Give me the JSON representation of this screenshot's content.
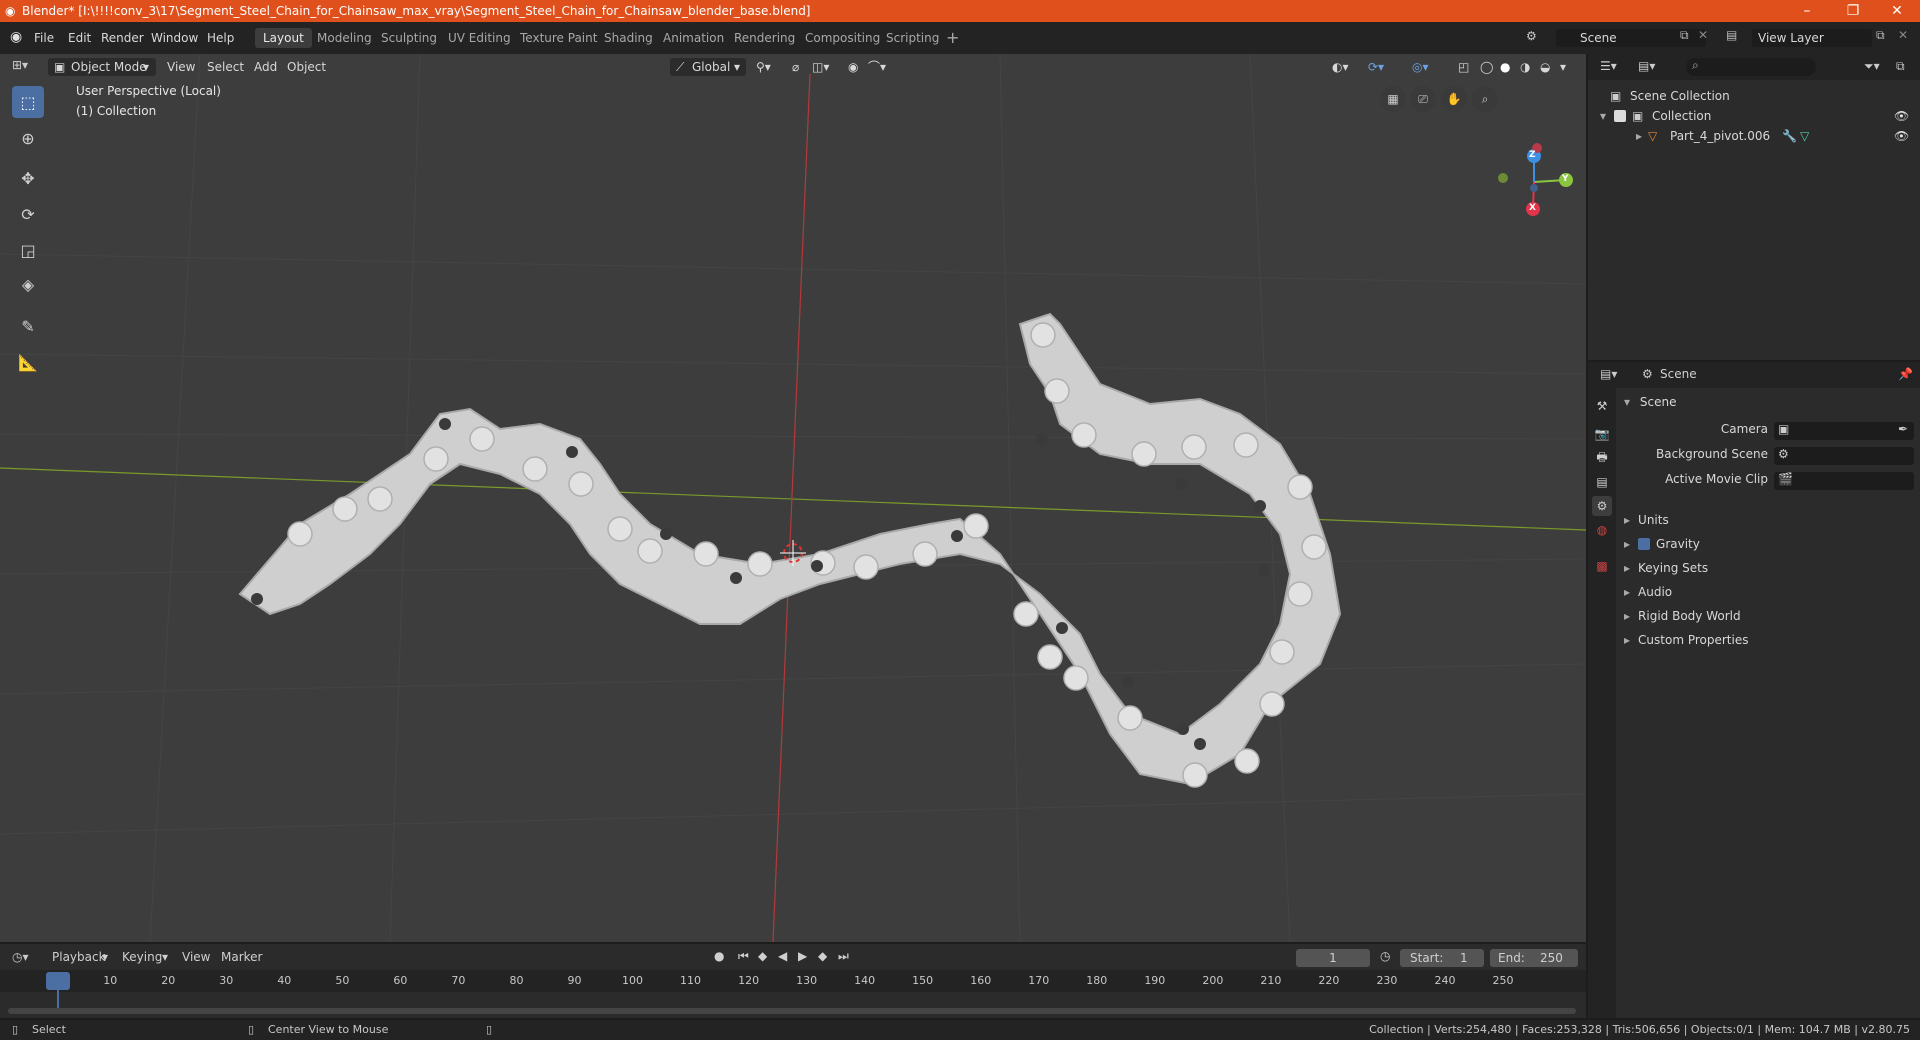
{
  "window": {
    "title": "Blender* [I:\\!!!!conv_3\\17\\Segment_Steel_Chain_for_Chainsaw_max_vray\\Segment_Steel_Chain_for_Chainsaw_blender_base.blend]",
    "minimize": "–",
    "maximize": "❐",
    "close": "✕"
  },
  "menu": [
    "File",
    "Edit",
    "Render",
    "Window",
    "Help"
  ],
  "workspaces": [
    "Layout",
    "Modeling",
    "Sculpting",
    "UV Editing",
    "Texture Paint",
    "Shading",
    "Animation",
    "Rendering",
    "Compositing",
    "Scripting"
  ],
  "active_workspace": "Layout",
  "scene_field": "Scene",
  "view_layer_field": "View Layer",
  "viewport_header": {
    "mode": "Object Mode",
    "view": "View",
    "select": "Select",
    "add": "Add",
    "object": "Object",
    "orientation": "Global"
  },
  "viewport_info": {
    "perspective": "User Perspective (Local)",
    "collection": "(1) Collection"
  },
  "gizmo": {
    "x": "X",
    "y": "Y",
    "z": "Z",
    "x_color": "#e3344b",
    "y_color": "#8bc53f",
    "z_color": "#3f8fe3"
  },
  "outliner": {
    "search_placeholder": "",
    "scene_collection": "Scene Collection",
    "collection": "Collection",
    "object": "Part_4_pivot.006"
  },
  "properties": {
    "header": "Scene",
    "panel": "Scene",
    "camera_label": "Camera",
    "background_scene_label": "Background Scene",
    "active_movie_clip_label": "Active Movie Clip",
    "sections": [
      "Units",
      "Gravity",
      "Keying Sets",
      "Audio",
      "Rigid Body World",
      "Custom Properties"
    ],
    "gravity_checked": true
  },
  "timeline": {
    "playback": "Playback",
    "keying": "Keying",
    "view": "View",
    "marker": "Marker",
    "current_frame": "1",
    "start_label": "Start:",
    "start_value": "1",
    "end_label": "End:",
    "end_value": "250",
    "ticks": [
      "1",
      "10",
      "20",
      "30",
      "40",
      "50",
      "60",
      "70",
      "80",
      "90",
      "100",
      "110",
      "120",
      "130",
      "140",
      "150",
      "160",
      "170",
      "180",
      "190",
      "200",
      "210",
      "220",
      "230",
      "240",
      "250"
    ]
  },
  "status": {
    "left_action": "Select",
    "middle_action": "Center View to Mouse",
    "stats": "Collection | Verts:254,480 | Faces:253,328 | Tris:506,656 | Objects:0/1 | Mem: 104.7 MB | v2.80.75"
  },
  "colors": {
    "titlebar": "#e0501c",
    "accent": "#4b6fa2",
    "viewport_bg": "#3d3d3d"
  }
}
